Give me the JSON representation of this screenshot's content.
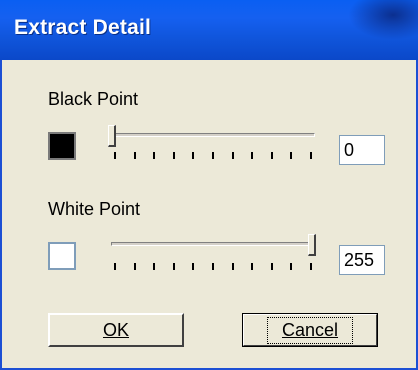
{
  "window": {
    "title": "Extract Detail"
  },
  "black_point": {
    "label": "Black Point",
    "value": "0",
    "slider_fraction": 0.0
  },
  "white_point": {
    "label": "White Point",
    "value": "255",
    "slider_fraction": 1.0
  },
  "buttons": {
    "ok_label": "OK",
    "cancel_label": "Cancel"
  },
  "colors": {
    "title_bar": "#0b55e0",
    "dialog_bg": "#ece9d8",
    "black_swatch": "#000000",
    "white_swatch": "#ffffff"
  },
  "icons": {
    "slider_thumb": "slider-thumb-icon"
  }
}
